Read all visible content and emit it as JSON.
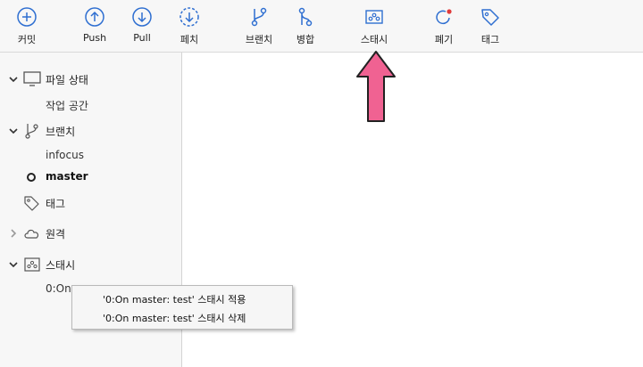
{
  "toolbar": {
    "commit": "커밋",
    "push": "Push",
    "pull": "Pull",
    "fetch": "페치",
    "branch": "브랜치",
    "merge": "병합",
    "stash": "스태시",
    "discard": "폐기",
    "tag": "태그"
  },
  "sidebar": {
    "file_status": "파일 상태",
    "working_copy": "작업 공간",
    "branches": "브랜치",
    "branch_infocus": "infocus",
    "branch_master": "master",
    "tags": "태그",
    "remotes": "원격",
    "stashes": "스태시",
    "stash_item": "0:On"
  },
  "context_menu": {
    "apply": "'0:On master: test' 스태시 적용",
    "delete": "'0:On master: test' 스태시 삭제"
  },
  "colors": {
    "accent_icon": "#2f6fd1",
    "discard_dot": "#e03a3a",
    "annotation_arrow": "#f06292"
  }
}
